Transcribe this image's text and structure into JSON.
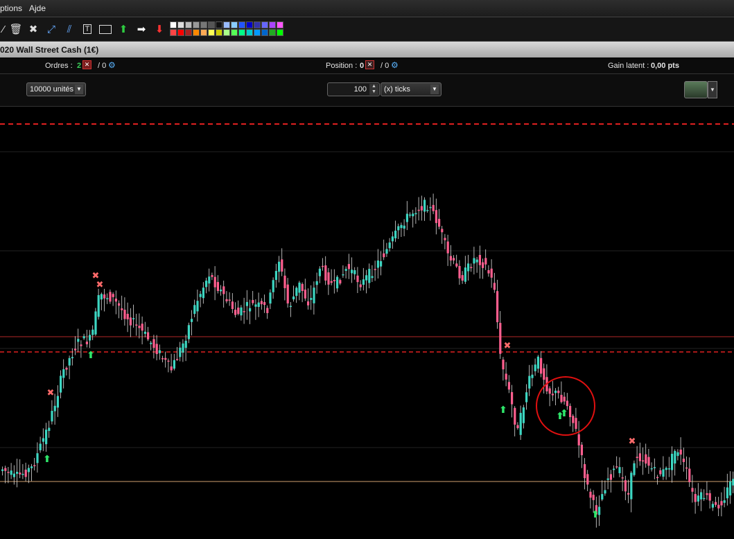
{
  "menu": {
    "options": "ptions",
    "aide": "Ajde"
  },
  "toolbar": {
    "icons": [
      "brush-icon",
      "trash-icon",
      "tools-icon",
      "line-icon",
      "parallel-lines-icon",
      "text-tool-icon",
      "rectangle-icon",
      "arrow-up-icon",
      "arrow-right-icon",
      "arrow-down-icon"
    ],
    "palette_colors": [
      "#ffffff",
      "#dddddd",
      "#bbbbbb",
      "#999999",
      "#777777",
      "#555555",
      "#111111",
      "#99bbff",
      "#88ccff",
      "#2255ff",
      "#0000cc",
      "#3333aa",
      "#6666ff",
      "#aa44ff",
      "#ff55ff",
      "#ff4444",
      "#ff0000",
      "#aa2222",
      "#ff8800",
      "#ffaa55",
      "#ffff55",
      "#cccc00",
      "#aaff88",
      "#55ff55",
      "#00ff88",
      "#00cccc",
      "#0099ff",
      "#0066cc",
      "#22aa22",
      "#00ff00"
    ]
  },
  "window": {
    "title": "020  Wall Street Cash (1€)"
  },
  "info": {
    "orders_label": "Ordres :",
    "orders_count": "2",
    "orders_sep": "/ 0",
    "position_label": "Position :",
    "position_count": "0",
    "position_sep": "/ 0",
    "gain_label": "Gain latent :",
    "gain_value": "0,00 pts"
  },
  "controls": {
    "units_value": "10000 unités",
    "ticks_value": "100",
    "ticks_unit": "(x) ticks"
  },
  "chart_data": {
    "type": "candlestick",
    "colors": {
      "up": "#3dd6c2",
      "down": "#ff5f8f",
      "wick": "#e0e0e0"
    }
  }
}
